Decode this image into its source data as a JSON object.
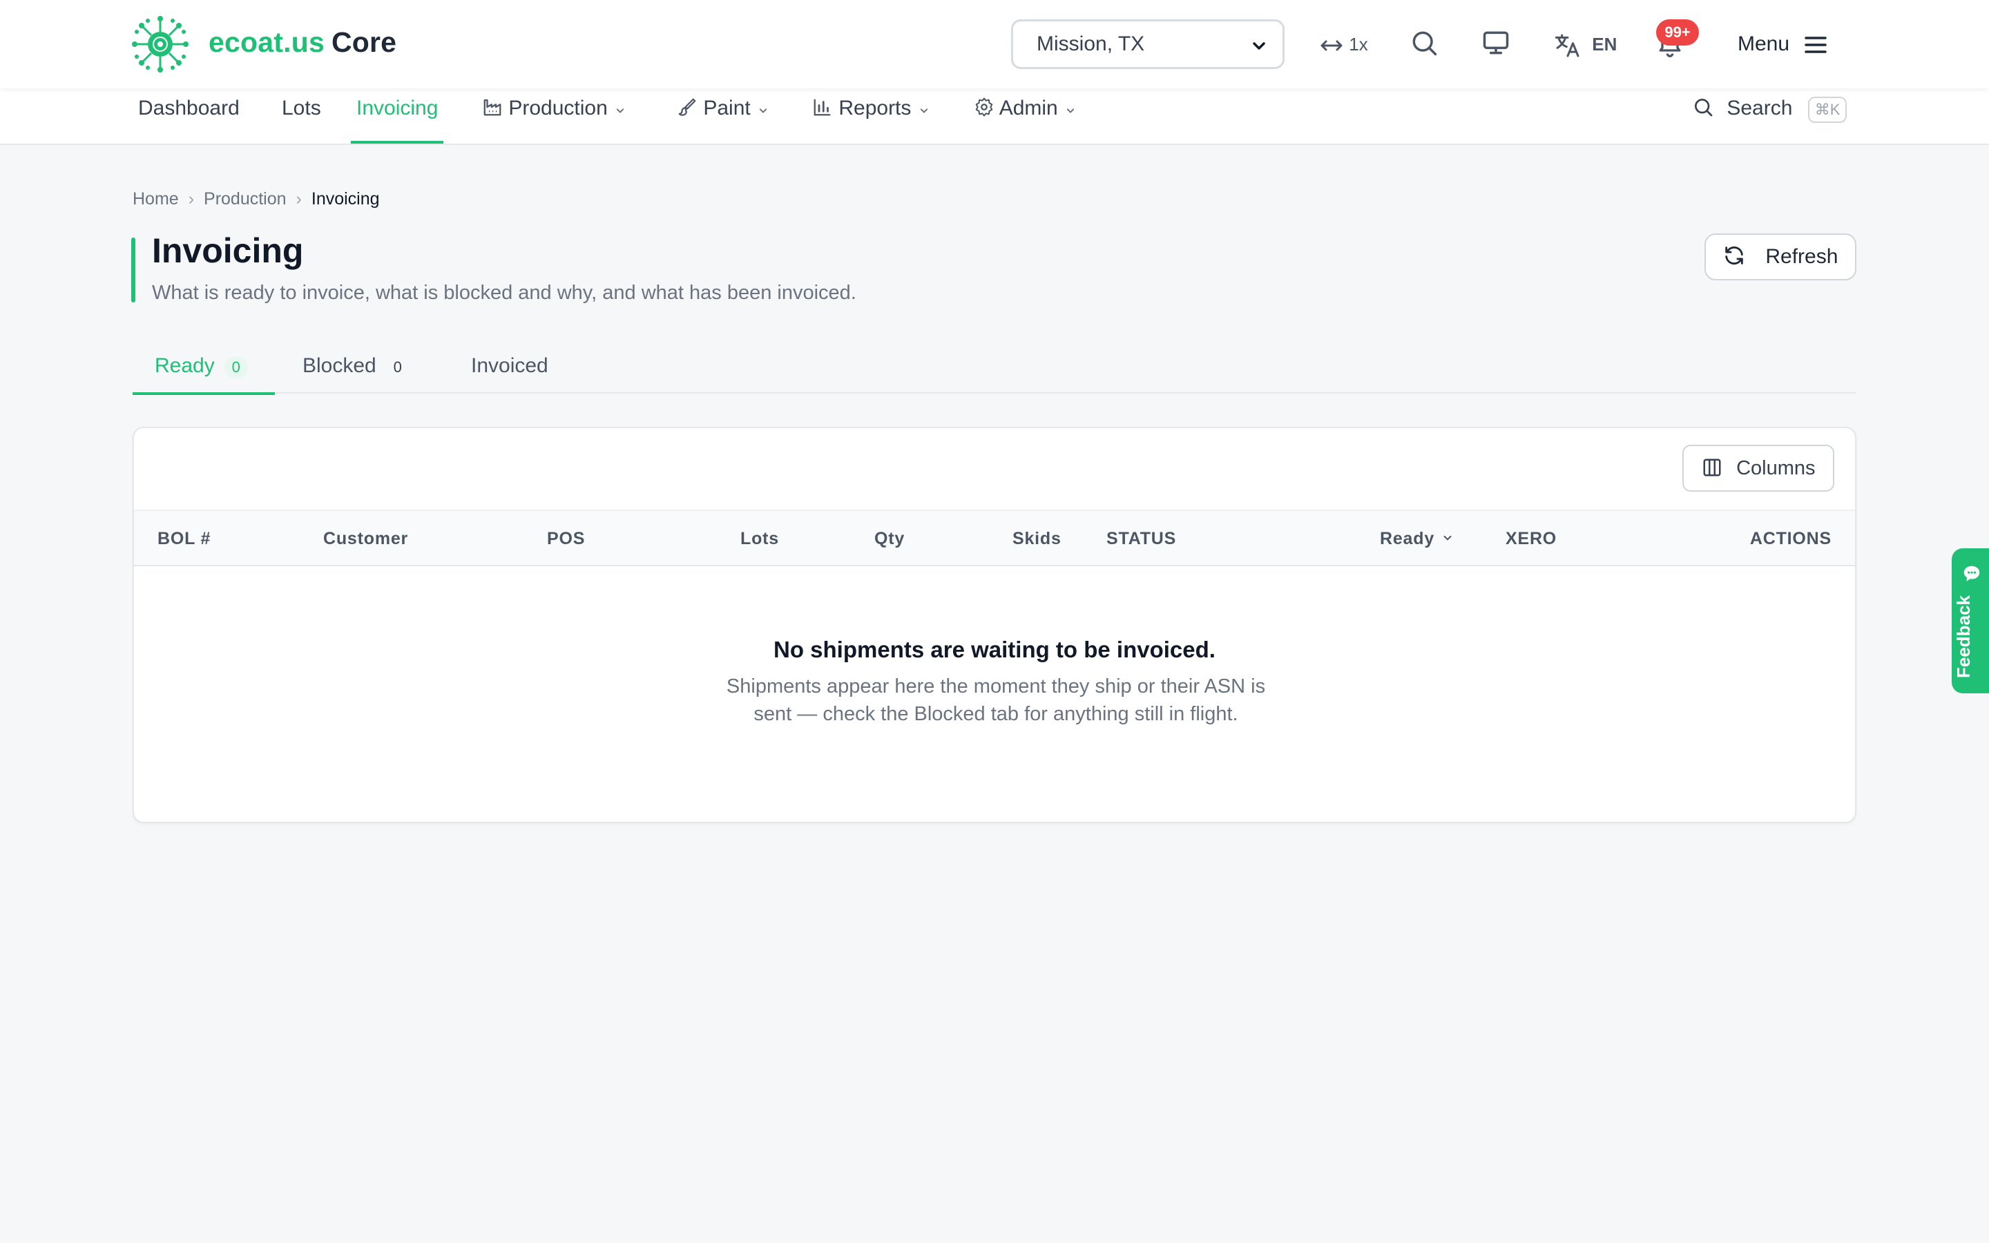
{
  "app": {
    "brand_primary": "ecoat.us",
    "brand_secondary": "Core",
    "accent_color": "#1fbf75"
  },
  "topbar": {
    "location": "Mission, TX",
    "width_scale": "1x",
    "language": "EN",
    "notifications_badge": "99+",
    "menu_label": "Menu",
    "icons": [
      "logo-icon",
      "width-arrows-icon",
      "search-icon",
      "monitor-icon",
      "translate-icon",
      "bell-icon",
      "hamburger-icon"
    ]
  },
  "nav": {
    "items": [
      {
        "label": "Dashboard"
      },
      {
        "label": "Lots"
      },
      {
        "label": "Invoicing",
        "active": true
      },
      {
        "label": "Production",
        "icon": "factory-icon",
        "dropdown": true
      },
      {
        "label": "Paint",
        "icon": "paintbrush-icon",
        "dropdown": true
      },
      {
        "label": "Reports",
        "icon": "bar-chart-icon",
        "dropdown": true
      },
      {
        "label": "Admin",
        "icon": "gear-icon",
        "dropdown": true
      }
    ],
    "search_label": "Search",
    "search_shortcut": "⌘K"
  },
  "breadcrumb": [
    "Home",
    "Production",
    "Invoicing"
  ],
  "page": {
    "title": "Invoicing",
    "subtitle": "What is ready to invoice, what is blocked and why, and what has been invoiced.",
    "refresh_label": "Refresh"
  },
  "tabs": [
    {
      "label": "Ready",
      "count": "0",
      "active": true
    },
    {
      "label": "Blocked",
      "count": "0"
    },
    {
      "label": "Invoiced"
    }
  ],
  "table": {
    "columns_button": "Columns",
    "headers": [
      "BOL #",
      "Customer",
      "POS",
      "Lots",
      "Qty",
      "Skids",
      "STATUS",
      "Ready",
      "XERO",
      "ACTIONS"
    ],
    "sort_column": "Ready",
    "empty_title": "No shipments are waiting to be invoiced.",
    "empty_body": "Shipments appear here the moment they ship or their ASN is sent — check the Blocked tab for anything still in flight."
  },
  "feedback": {
    "label": "Feedback"
  }
}
